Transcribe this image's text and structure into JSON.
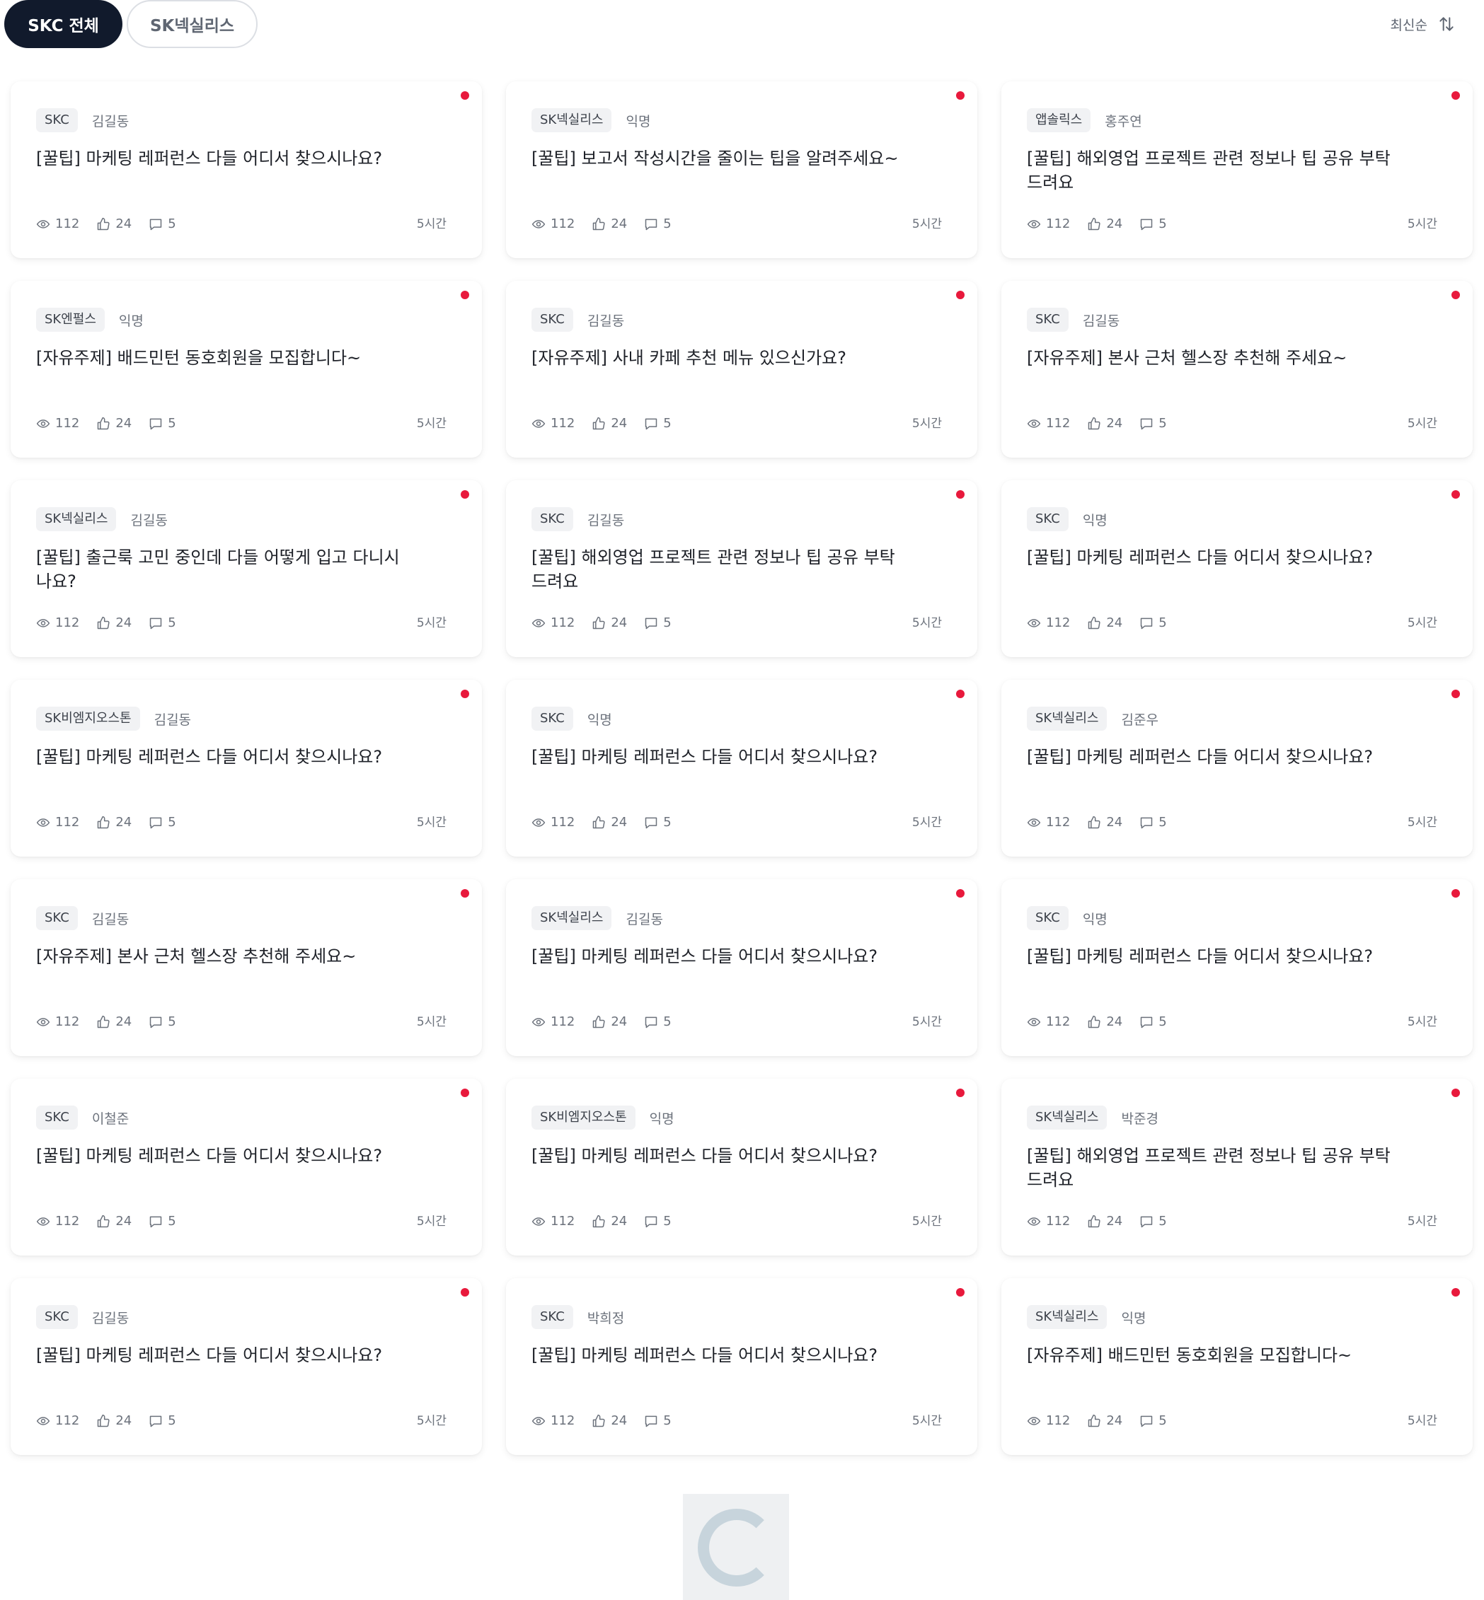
{
  "tabs": {
    "active": "SKC 전체",
    "inactive": "SK넥실리스"
  },
  "sort": {
    "label": "최신순",
    "icon": "sort-arrows-icon"
  },
  "colors": {
    "accent_dark": "#111a2c",
    "new_dot": "#e8193c"
  },
  "icons": {
    "views": "eye-icon",
    "likes": "thumbs-up-icon",
    "comments": "comment-icon"
  },
  "posts": [
    {
      "company": "SKC",
      "author": "김길동",
      "title": "[꿀팁] 마케팅 레퍼런스 다들 어디서 찾으시나요?",
      "views": "112",
      "likes": "24",
      "comments": "5",
      "time": "5시간"
    },
    {
      "company": "SK넥실리스",
      "author": "익명",
      "title": "[꿀팁] 보고서 작성시간을 줄이는 팁을 알려주세요~",
      "views": "112",
      "likes": "24",
      "comments": "5",
      "time": "5시간"
    },
    {
      "company": "앱솔릭스",
      "author": "홍주연",
      "title": "[꿀팁] 해외영업 프로젝트 관련 정보나 팁 공유 부탁드려요",
      "views": "112",
      "likes": "24",
      "comments": "5",
      "time": "5시간"
    },
    {
      "company": "SK엔펄스",
      "author": "익명",
      "title": "[자유주제] 배드민턴 동호회원을 모집합니다~",
      "views": "112",
      "likes": "24",
      "comments": "5",
      "time": "5시간"
    },
    {
      "company": "SKC",
      "author": "김길동",
      "title": "[자유주제] 사내 카페 추천 메뉴 있으신가요?",
      "views": "112",
      "likes": "24",
      "comments": "5",
      "time": "5시간"
    },
    {
      "company": "SKC",
      "author": "김길동",
      "title": "[자유주제] 본사 근처 헬스장 추천해 주세요~",
      "views": "112",
      "likes": "24",
      "comments": "5",
      "time": "5시간"
    },
    {
      "company": "SK넥실리스",
      "author": "김길동",
      "title": "[꿀팁] 출근룩 고민 중인데 다들 어떻게 입고 다니시나요?",
      "views": "112",
      "likes": "24",
      "comments": "5",
      "time": "5시간"
    },
    {
      "company": "SKC",
      "author": "김길동",
      "title": "[꿀팁] 해외영업 프로젝트 관련 정보나 팁 공유 부탁드려요",
      "views": "112",
      "likes": "24",
      "comments": "5",
      "time": "5시간"
    },
    {
      "company": "SKC",
      "author": "익명",
      "title": "[꿀팁] 마케팅 레퍼런스 다들 어디서 찾으시나요?",
      "views": "112",
      "likes": "24",
      "comments": "5",
      "time": "5시간"
    },
    {
      "company": "SK비엠지오스톤",
      "author": "김길동",
      "title": "[꿀팁] 마케팅 레퍼런스 다들 어디서 찾으시나요?",
      "views": "112",
      "likes": "24",
      "comments": "5",
      "time": "5시간"
    },
    {
      "company": "SKC",
      "author": "익명",
      "title": "[꿀팁] 마케팅 레퍼런스 다들 어디서 찾으시나요?",
      "views": "112",
      "likes": "24",
      "comments": "5",
      "time": "5시간"
    },
    {
      "company": "SK넥실리스",
      "author": "김준우",
      "title": "[꿀팁] 마케팅 레퍼런스 다들 어디서 찾으시나요?",
      "views": "112",
      "likes": "24",
      "comments": "5",
      "time": "5시간"
    },
    {
      "company": "SKC",
      "author": "김길동",
      "title": "[자유주제] 본사 근처 헬스장 추천해 주세요~",
      "views": "112",
      "likes": "24",
      "comments": "5",
      "time": "5시간"
    },
    {
      "company": "SK넥실리스",
      "author": "김길동",
      "title": "[꿀팁] 마케팅 레퍼런스 다들 어디서 찾으시나요?",
      "views": "112",
      "likes": "24",
      "comments": "5",
      "time": "5시간"
    },
    {
      "company": "SKC",
      "author": "익명",
      "title": "[꿀팁] 마케팅 레퍼런스 다들 어디서 찾으시나요?",
      "views": "112",
      "likes": "24",
      "comments": "5",
      "time": "5시간"
    },
    {
      "company": "SKC",
      "author": "이철준",
      "title": "[꿀팁] 마케팅 레퍼런스 다들 어디서 찾으시나요?",
      "views": "112",
      "likes": "24",
      "comments": "5",
      "time": "5시간"
    },
    {
      "company": "SK비엠지오스톤",
      "author": "익명",
      "title": "[꿀팁] 마케팅 레퍼런스 다들 어디서 찾으시나요?",
      "views": "112",
      "likes": "24",
      "comments": "5",
      "time": "5시간"
    },
    {
      "company": "SK넥실리스",
      "author": "박준경",
      "title": "[꿀팁] 해외영업 프로젝트 관련 정보나 팁 공유 부탁드려요",
      "views": "112",
      "likes": "24",
      "comments": "5",
      "time": "5시간"
    },
    {
      "company": "SKC",
      "author": "김길동",
      "title": "[꿀팁] 마케팅 레퍼런스 다들 어디서 찾으시나요?",
      "views": "112",
      "likes": "24",
      "comments": "5",
      "time": "5시간"
    },
    {
      "company": "SKC",
      "author": "박희정",
      "title": "[꿀팁] 마케팅 레퍼런스 다들 어디서 찾으시나요?",
      "views": "112",
      "likes": "24",
      "comments": "5",
      "time": "5시간"
    },
    {
      "company": "SK넥실리스",
      "author": "익명",
      "title": "[자유주제] 배드민턴 동호회원을 모집합니다~",
      "views": "112",
      "likes": "24",
      "comments": "5",
      "time": "5시간"
    }
  ]
}
